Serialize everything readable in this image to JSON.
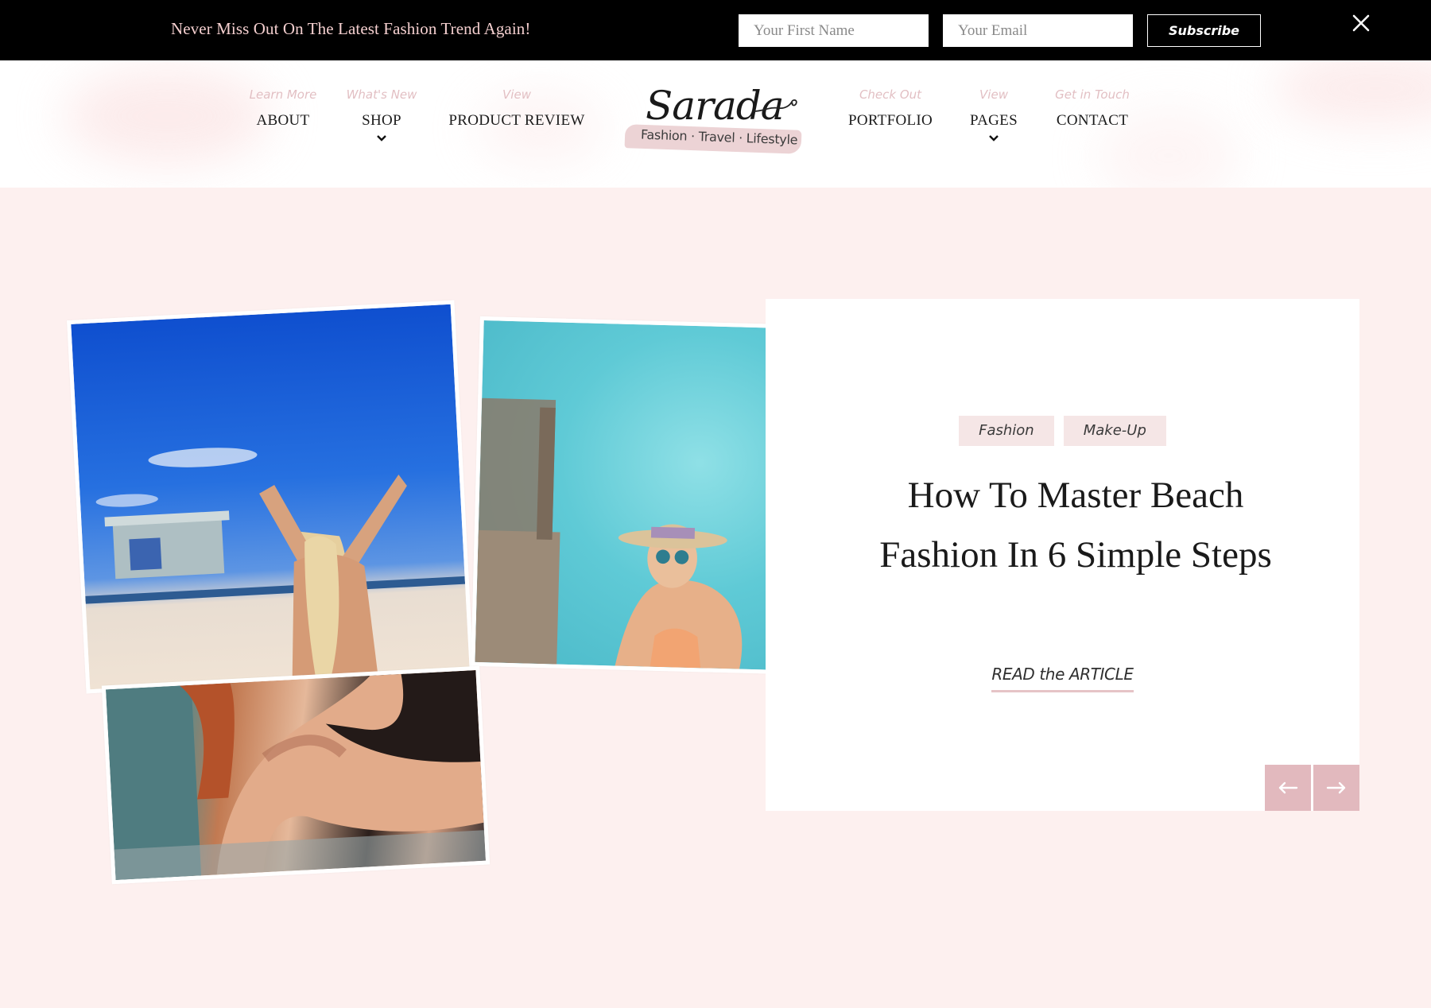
{
  "colors": {
    "topbar_bg": "#000000",
    "promo_text": "#f4cfcf",
    "page_bg": "#fdf0ef",
    "kicker": "#e2bfc3",
    "tag_bg": "#f5e6e6",
    "arrow_bg": "#e2b9be"
  },
  "topbar": {
    "promo": "Never Miss Out On The Latest Fashion Trend Again!",
    "first_name_placeholder": "Your First Name",
    "first_name_value": "",
    "email_placeholder": "Your Email",
    "email_value": "",
    "subscribe_label": "Subscribe",
    "close_icon": "close-x-icon"
  },
  "nav": {
    "left": [
      {
        "kicker": "Learn More",
        "label": "ABOUT",
        "dropdown": false
      },
      {
        "kicker": "What's New",
        "label": "SHOP",
        "dropdown": true
      },
      {
        "kicker": "View",
        "label": "PRODUCT REVIEW",
        "dropdown": false
      }
    ],
    "right": [
      {
        "kicker": "Check Out",
        "label": "PORTFOLIO",
        "dropdown": false
      },
      {
        "kicker": "View",
        "label": "PAGES",
        "dropdown": true
      },
      {
        "kicker": "Get in Touch",
        "label": "CONTACT",
        "dropdown": false
      }
    ]
  },
  "logo": {
    "name": "Sarada",
    "tagline": "Fashion · Travel · Lifestyle"
  },
  "hero": {
    "photos": [
      {
        "alt": "Woman on beach throwing sand near lifeguard tower"
      },
      {
        "alt": "Woman in hat and sunglasses climbing ladder from turquoise sea"
      },
      {
        "alt": "Close-up of woman in black swimsuit sitting"
      }
    ],
    "tags": [
      "Fashion",
      "Make-Up"
    ],
    "title": "How To Master Beach Fashion In 6 Simple Steps",
    "cta": "READ the ARTICLE",
    "prev_icon": "arrow-left-icon",
    "next_icon": "arrow-right-icon"
  }
}
